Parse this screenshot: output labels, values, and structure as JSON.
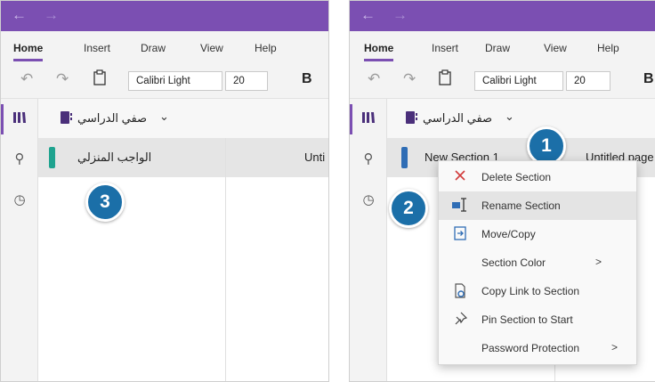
{
  "colors": {
    "accent": "#7b4fb2",
    "callout": "#1b6fa8",
    "section_teal": "#1fa38f",
    "section_blue": "#2f6db5"
  },
  "nav": {
    "back": "←",
    "forward": "→"
  },
  "ribbon_tabs": [
    "Home",
    "Insert",
    "Draw",
    "View",
    "Help"
  ],
  "toolbar": {
    "font_name": "Calibri Light",
    "font_size": "20",
    "bold": "B"
  },
  "sidebar_icons": [
    "notebooks-icon",
    "search-icon",
    "recent-icon"
  ],
  "left_panel": {
    "notebook_title": "صفي الدراسي",
    "section_name": "الواجب المنزلي",
    "page_name": "Unti",
    "callout": "3"
  },
  "right_panel": {
    "notebook_title": "صفي الدراسي",
    "section_name": "New Section 1",
    "page_name": "Untitled page",
    "callout_section": "1",
    "callout_rename": "2"
  },
  "context_menu": [
    {
      "label": "Delete Section",
      "icon": "delete-icon"
    },
    {
      "label": "Rename Section",
      "icon": "rename-icon"
    },
    {
      "label": "Move/Copy",
      "icon": "move-copy-icon"
    },
    {
      "label": "Section Color",
      "icon": "",
      "submenu": true
    },
    {
      "label": "Copy Link to Section",
      "icon": "copy-link-icon"
    },
    {
      "label": "Pin Section to Start",
      "icon": "pin-icon"
    },
    {
      "label": "Password Protection",
      "icon": "",
      "submenu": true
    }
  ],
  "submenu_arrow": ">"
}
